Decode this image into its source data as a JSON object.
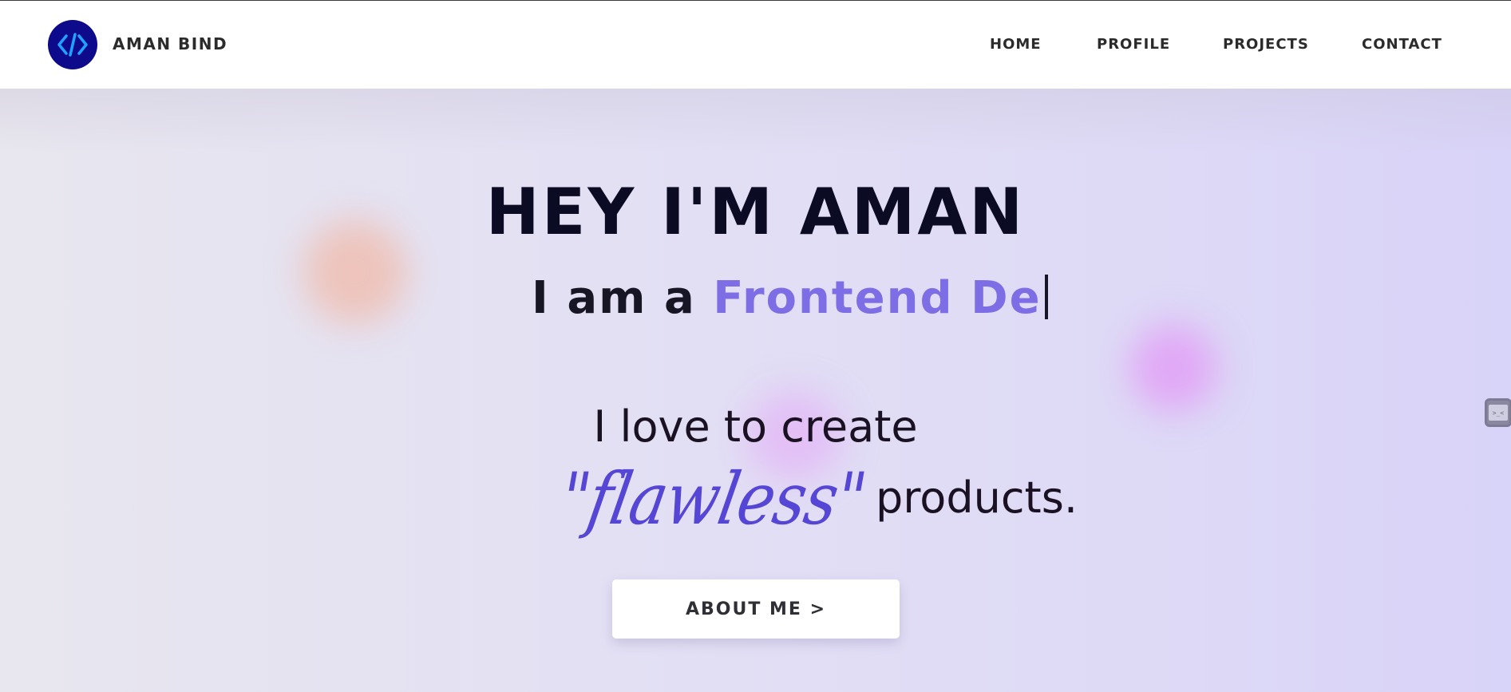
{
  "brand": {
    "name": "AMAN BIND",
    "logo_icon": "code-brackets-icon",
    "logo_color": "#0d0a8c",
    "logo_accent": "#1fa3ff"
  },
  "nav": [
    {
      "label": "HOME"
    },
    {
      "label": "PROFILE"
    },
    {
      "label": "PROJECTS"
    },
    {
      "label": "CONTACT"
    }
  ],
  "hero": {
    "headline": "HEY I'M AMAN",
    "typing_prefix": "I am a ",
    "typing_role": "Frontend De",
    "tagline_line1": "I love to create",
    "tagline_highlight": "\"flawless\"",
    "tagline_suffix": "products.",
    "cta_label": "ABOUT ME >",
    "accent_color": "#7e6ee6"
  },
  "side_widget": {
    "icon": "terminal-face-icon",
    "glyph": ">_<"
  }
}
